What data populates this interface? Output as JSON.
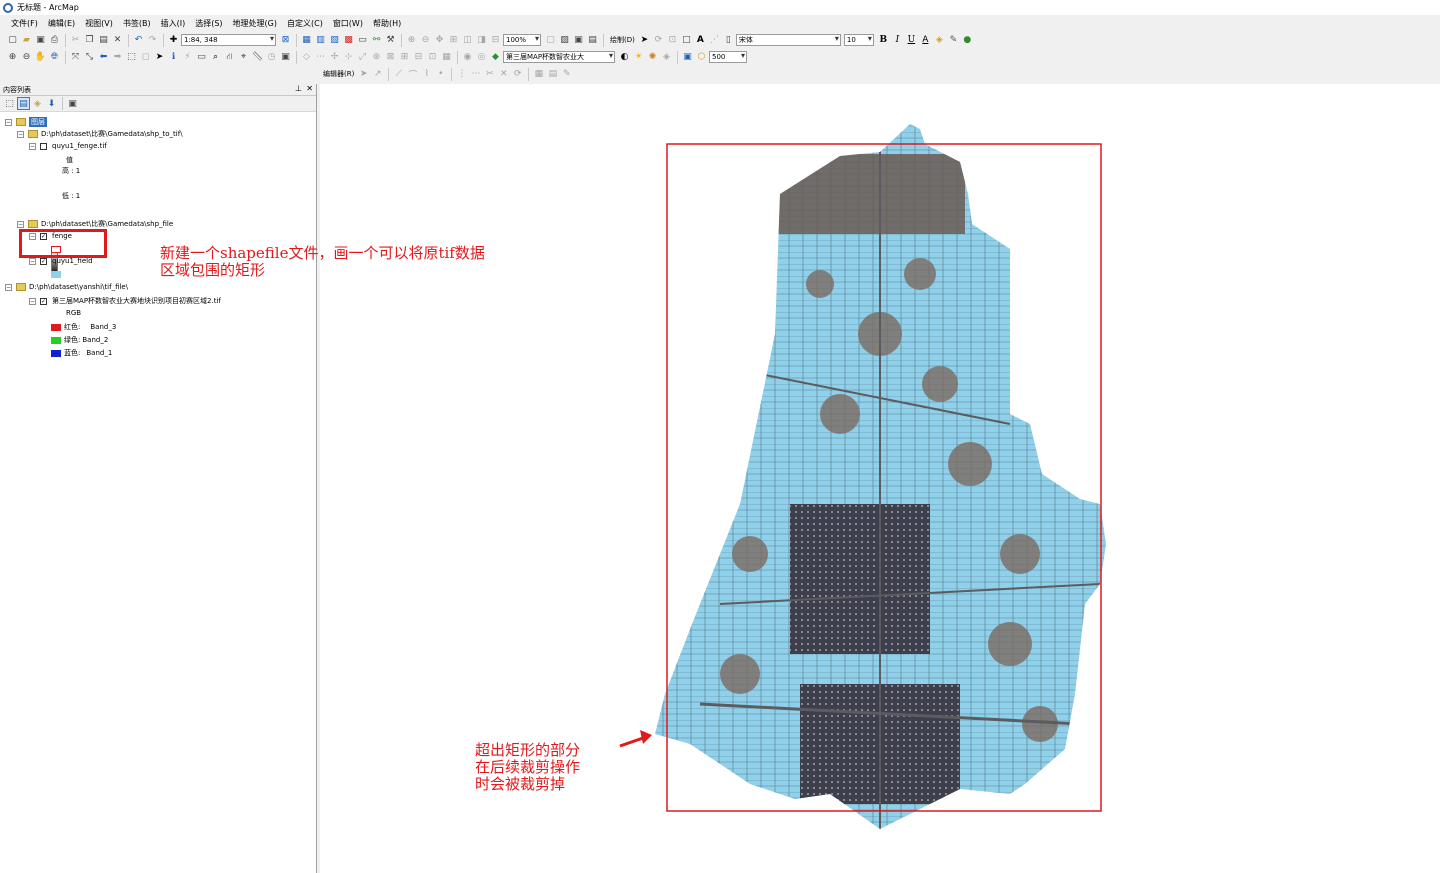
{
  "window": {
    "title": "无标题 - ArcMap"
  },
  "menu": [
    "文件(F)",
    "编辑(E)",
    "视图(V)",
    "书签(B)",
    "插入(I)",
    "选择(S)",
    "地理处理(G)",
    "自定义(C)",
    "窗口(W)",
    "帮助(H)"
  ],
  "toolbar": {
    "scale": "1:84, 348",
    "zoom": "100%",
    "draw_label": "绘制(D)",
    "font_name": "宋体",
    "font_size": "10",
    "bold": "B",
    "italic": "I",
    "underline": "U",
    "layer_combo": "第三届MAP杯数智农业大",
    "resolution": "500",
    "editor_label": "编辑器(R)"
  },
  "toc": {
    "title": "内容列表",
    "layers_root": "图层",
    "group1": {
      "path": "D:\\ph\\dataset\\比赛\\Gamedata\\shp_to_tif\\",
      "layer": "quyu1_fenge.tif",
      "value_label": "值",
      "high": "高 : 1",
      "low": "低 : 1"
    },
    "group2": {
      "path": "D:\\ph\\dataset\\比赛\\Gamedata\\shp_file",
      "layer1": "fenge",
      "layer2": "quyu1_field"
    },
    "group3": {
      "path": "D:\\ph\\dataset\\yanshi\\tif_file\\",
      "layer": "第三届MAP杯数智农业大赛地块识别项目初赛区域2.tif",
      "rgb": "RGB",
      "bands": [
        {
          "label": "红色:",
          "band": "Band_3",
          "color": "#e0191c"
        },
        {
          "label": "绿色:",
          "band": "Band_2",
          "color": "#22d022"
        },
        {
          "label": "蓝色:",
          "band": "Band_1",
          "color": "#1020d0"
        }
      ]
    }
  },
  "annotations": {
    "note1_line1": "新建一个shapefile文件，画一个可以将原tif数据",
    "note1_line2": "区域包围的矩形",
    "note2_line1": "超出矩形的部分",
    "note2_line2": "在后续裁剪操作",
    "note2_line3": "时会被裁剪掉"
  },
  "colors": {
    "accent_red": "#e0191c",
    "field_fill": "#8fd0ea",
    "imagery": "#5a5a60"
  },
  "icons": [
    "new-doc-icon",
    "open-icon",
    "save-icon",
    "print-icon",
    "cut-icon",
    "copy-icon",
    "paste-icon",
    "delete-icon",
    "undo-icon",
    "redo-icon",
    "add-data-icon",
    "zoom-in-icon",
    "zoom-out-icon",
    "pan-icon",
    "full-extent-icon",
    "identify-icon",
    "find-icon",
    "select-icon",
    "editor-icon"
  ]
}
